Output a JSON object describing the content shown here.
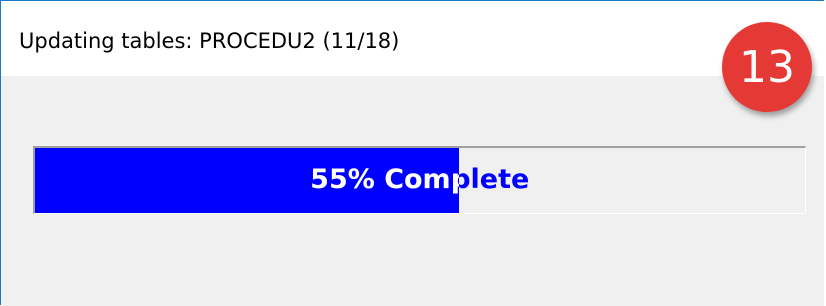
{
  "window": {
    "title": "Updating tables: PROCEDU2 (11/18)"
  },
  "progress": {
    "percent": 55,
    "label": "55% Complete",
    "fill_color": "#0000ff",
    "text_color": "#0000ff"
  },
  "badge": {
    "number": "13",
    "color": "#e53935"
  }
}
